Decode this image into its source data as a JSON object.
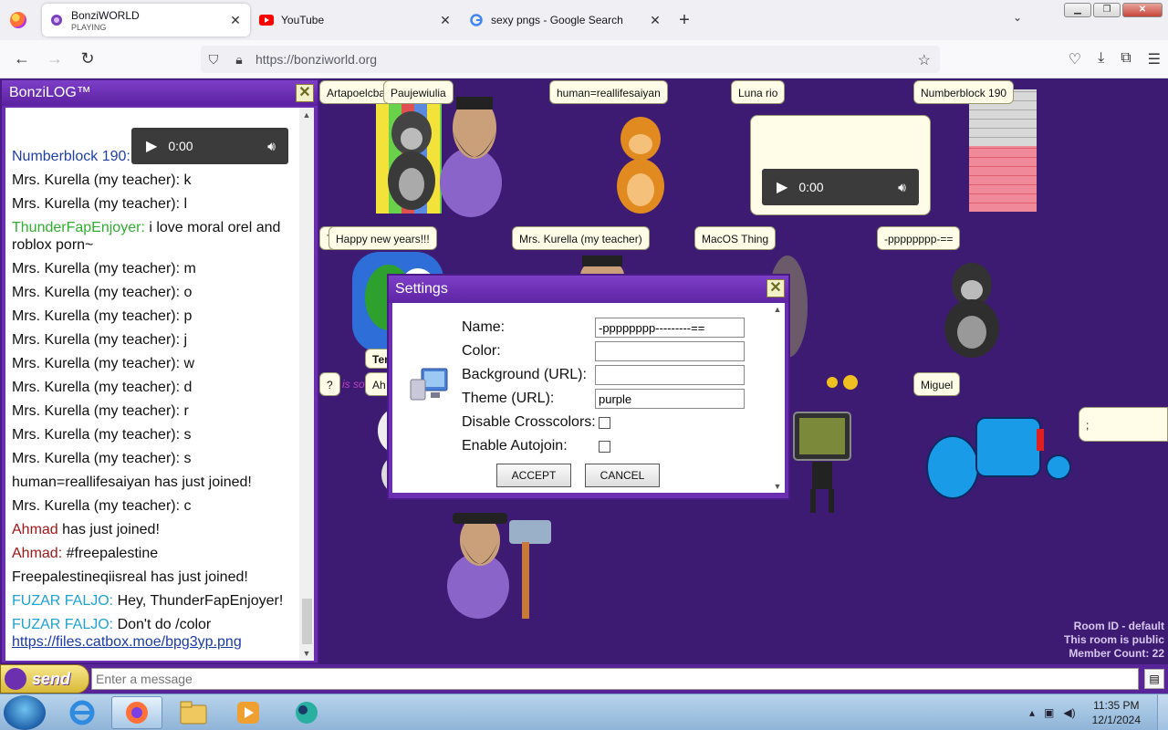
{
  "browser": {
    "tabs": [
      {
        "title": "BonziWORLD",
        "subtitle": "PLAYING",
        "icon": "bonzi-favicon-icon",
        "active": true
      },
      {
        "title": "YouTube",
        "icon": "youtube-icon",
        "active": false
      },
      {
        "title": "sexy pngs - Google Search",
        "icon": "google-icon",
        "active": false
      }
    ],
    "url": "https://bonziworld.org"
  },
  "log": {
    "title": "BonziLOG™",
    "audio_time": "0:00",
    "lines": [
      {
        "name": "Numberblock 190:",
        "text": "",
        "color": "blue"
      },
      {
        "name": "",
        "text": "Mrs. Kurella (my teacher): k"
      },
      {
        "name": "",
        "text": "Mrs. Kurella (my teacher): l"
      },
      {
        "name": "ThunderFapEnjoyer:",
        "text": "i love moral orel and roblox porn~",
        "color": "green"
      },
      {
        "name": "",
        "text": "Mrs. Kurella (my teacher): m"
      },
      {
        "name": "",
        "text": "Mrs. Kurella (my teacher): o"
      },
      {
        "name": "",
        "text": "Mrs. Kurella (my teacher): p"
      },
      {
        "name": "",
        "text": "Mrs. Kurella (my teacher): j"
      },
      {
        "name": "",
        "text": "Mrs. Kurella (my teacher): w"
      },
      {
        "name": "",
        "text": "Mrs. Kurella (my teacher): d"
      },
      {
        "name": "",
        "text": "Mrs. Kurella (my teacher): r"
      },
      {
        "name": "",
        "text": "Mrs. Kurella (my teacher): s"
      },
      {
        "name": "",
        "text": "Mrs. Kurella (my teacher): s"
      },
      {
        "name": "",
        "text": "human=reallifesaiyan has just joined!"
      },
      {
        "name": "",
        "text": "Mrs. Kurella (my teacher): c"
      },
      {
        "name": "Ahmad",
        "text": "has just joined!",
        "color": "red"
      },
      {
        "name": "Ahmad:",
        "text": "#freepalestine",
        "color": "red"
      },
      {
        "name": "",
        "text": "Freepalestineqiisreal has just joined!"
      },
      {
        "name": "FUZAR FALJO:",
        "text": "Hey, ThunderFapEnjoyer!",
        "color": "cyan"
      },
      {
        "name": "FUZAR FALJO:",
        "text": "Don't do /color",
        "color": "cyan"
      }
    ],
    "link": "https://files.catbox.moe/bpg3yp.png"
  },
  "stage": {
    "name_tags": {
      "artapo": "Artapoelcba",
      "paujewiulia": "Paujewiulia",
      "human": "human=reallifesaiyan",
      "luna": "Luna rio",
      "numberblock": "Numberblock 190",
      "happy": "Happy new years!!!",
      "kurella": "Mrs. Kurella (my teacher)",
      "macos": "MacOS Thing",
      "pppp": "-pppppppp-==",
      "miguel": "Miguel",
      "q": "?",
      "ahm": "Ah",
      "semicolon": ";",
      "t": "T",
      "ter": "Ter",
      "isson": "is son"
    },
    "audio_time": "0:00",
    "room_info": [
      "Room ID - default",
      "This room is public",
      "Member Count: 22"
    ]
  },
  "settings": {
    "title": "Settings",
    "fields": {
      "name_label": "Name:",
      "name_value": "-pppppppp---------==",
      "color_label": "Color:",
      "color_value": "",
      "bg_label": "Background (URL):",
      "bg_value": "",
      "theme_label": "Theme (URL):",
      "theme_value": "purple",
      "crosscolors_label": "Disable Crosscolors:",
      "autojoin_label": "Enable Autojoin:"
    },
    "accept_label": "ACCEPT",
    "cancel_label": "CANCEL"
  },
  "message_bar": {
    "send_label": "send",
    "placeholder": "Enter a message"
  },
  "taskbar": {
    "time": "11:35 PM",
    "date": "12/1/2024"
  },
  "colors": {
    "panel_purple": "#6a2fb0",
    "stage_purple": "#3d1b73",
    "name_blue": "#1f3fa7",
    "name_green": "#2fae2f",
    "name_red": "#a01818",
    "name_cyan": "#1ea3d4"
  }
}
